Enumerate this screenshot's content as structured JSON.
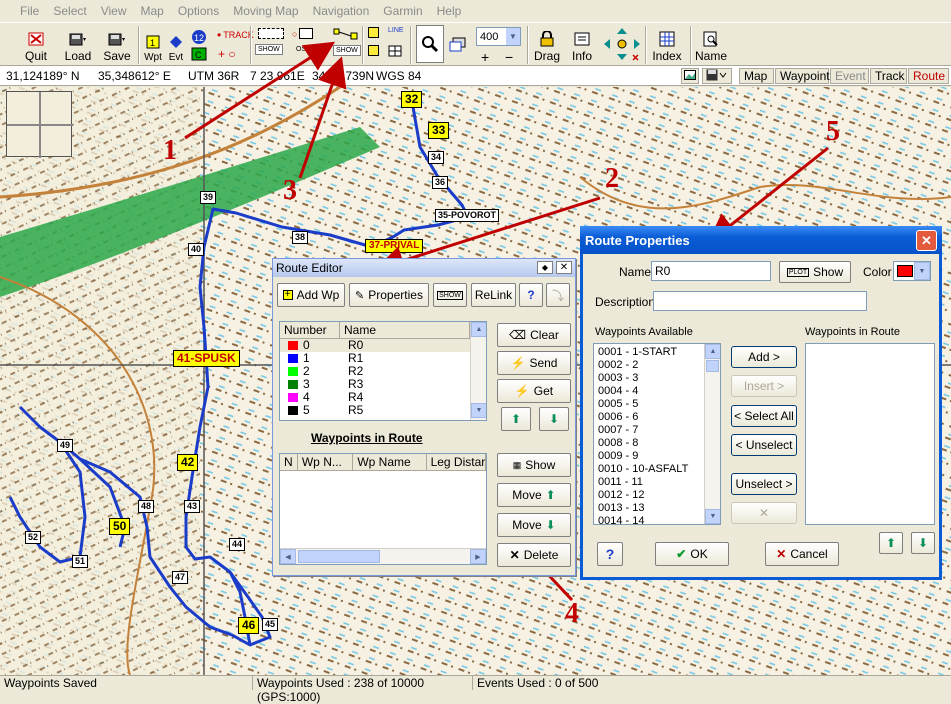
{
  "menu": [
    "File",
    "Select",
    "View",
    "Map",
    "Options",
    "Moving Map",
    "Navigation",
    "Garmin",
    "Help"
  ],
  "toolbar": {
    "quit": "Quit",
    "load": "Load",
    "save": "Save",
    "wpt": "Wpt",
    "evt": "Evt",
    "track": "TRACK",
    "show": "SHOW",
    "osm": "OSM",
    "line": "LINE",
    "zoom": "400",
    "drag": "Drag",
    "info": "Info",
    "index": "Index",
    "name": "Name"
  },
  "coords": {
    "lat": "31,124189° N",
    "lon": "35,348612° E",
    "utm": "UTM  36R",
    "east": "7 23 961E",
    "north": "34 43 739N",
    "datum": "WGS 84"
  },
  "view_tabs": [
    "Map",
    "Waypoint",
    "Event",
    "Track",
    "Route"
  ],
  "map_labels": {
    "wp32": "32",
    "wp33": "33",
    "wp34": "34",
    "wp36": "36",
    "wp35": "35-POVOROT",
    "wp39": "39",
    "wp38": "38",
    "wp37": "37-PRIVAL",
    "wp40": "40",
    "wp41": "41-SPUSK",
    "wp42": "42",
    "wp43": "43",
    "wp44": "44",
    "wp45": "45",
    "wp46": "46",
    "wp47": "47",
    "wp48": "48",
    "wp49": "49",
    "wp50": "50",
    "wp51": "51",
    "wp52": "52"
  },
  "annotations": [
    "1",
    "2",
    "3",
    "4",
    "5"
  ],
  "route_editor": {
    "title": "Route Editor",
    "add_wp": "Add Wp",
    "properties": "Properties",
    "relink": "ReLink",
    "col_number": "Number",
    "col_name": "Name",
    "routes": [
      {
        "num": "0",
        "name": "R0",
        "color": "#ff0000"
      },
      {
        "num": "1",
        "name": "R1",
        "color": "#0000ff"
      },
      {
        "num": "2",
        "name": "R2",
        "color": "#00ff00"
      },
      {
        "num": "3",
        "name": "R3",
        "color": "#008000"
      },
      {
        "num": "4",
        "name": "R4",
        "color": "#ff00ff"
      },
      {
        "num": "5",
        "name": "R5",
        "color": "#000000"
      }
    ],
    "clear": "Clear",
    "send": "Send",
    "get": "Get",
    "wp_in_route": "Waypoints in Route",
    "wp_cols": [
      "N",
      "Wp N...",
      "Wp Name",
      "Leg Distar"
    ],
    "show": "Show",
    "move_up": "Move",
    "move_down": "Move",
    "delete": "Delete"
  },
  "route_props": {
    "title": "Route Properties",
    "name_label": "Name",
    "name_value": "R0",
    "plot_show": "Show",
    "color_label": "Color",
    "color_value": "#ff0000",
    "desc_label": "Description",
    "wp_available_label": "Waypoints Available",
    "wp_route_label": "Waypoints in Route",
    "waypoints": [
      "0001 - 1-START",
      "0002 - 2",
      "0003 - 3",
      "0004 - 4",
      "0005 - 5",
      "0006 - 6",
      "0007 - 7",
      "0008 - 8",
      "0009 - 9",
      "0010 - 10-ASFALT",
      "0011 - 11",
      "0012 - 12",
      "0013 - 13",
      "0014 - 14"
    ],
    "add": "Add >",
    "insert": "Insert >",
    "select_all": "< Select All",
    "unselect_left": "< Unselect",
    "unselect_right": "Unselect >",
    "ok": "OK",
    "cancel": "Cancel"
  },
  "status": {
    "left": "Waypoints Saved",
    "used": "Waypoints Used : 238 of 10000  (GPS:1000)",
    "events": "Events Used : 0 of 500"
  }
}
